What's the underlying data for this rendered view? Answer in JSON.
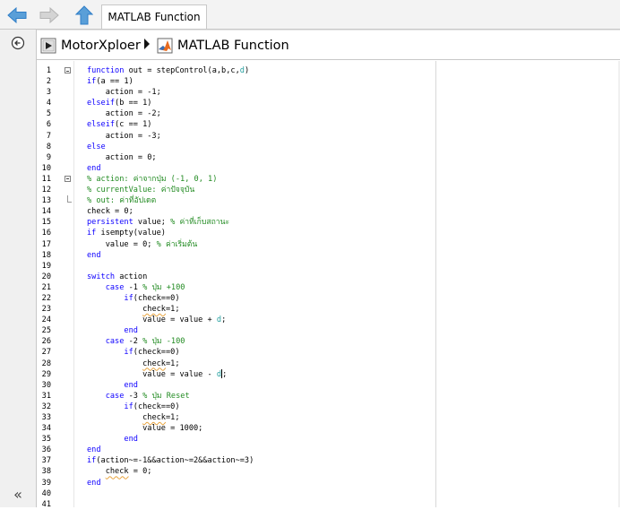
{
  "toolbar": {
    "back_icon": "arrow-left-icon",
    "forward_icon": "arrow-right-icon",
    "up_icon": "arrow-up-icon",
    "tab_label": "MATLAB Function"
  },
  "breadcrumb": {
    "model": "MotorXploer",
    "block": "MATLAB Function"
  },
  "sidebar": {
    "hide_icon": "collapse-icon",
    "collapse_label": "«"
  },
  "colors": {
    "keyword": "#0e00ff",
    "comment": "#228b22",
    "persistent_var": "#26a0a0",
    "nav_arrow": "#2f7ec7"
  },
  "editor": {
    "lines": [
      {
        "n": "1",
        "html": "<span class=\"kw\">function</span> out = stepControl(a,b,c,<span class=\"pv\">d</span>)"
      },
      {
        "n": "2",
        "html": "<span class=\"kw\">if</span>(a == 1)"
      },
      {
        "n": "3",
        "html": "    action = -1;"
      },
      {
        "n": "4",
        "html": "<span class=\"kw\">elseif</span>(b == 1)"
      },
      {
        "n": "5",
        "html": "    action = -2;"
      },
      {
        "n": "6",
        "html": "<span class=\"kw\">elseif</span>(c == 1)"
      },
      {
        "n": "7",
        "html": "    action = -3;"
      },
      {
        "n": "8",
        "html": "<span class=\"kw\">else</span>"
      },
      {
        "n": "9",
        "html": "    action = 0;"
      },
      {
        "n": "10",
        "html": "<span class=\"kw\">end</span>"
      },
      {
        "n": "11",
        "html": "<span class=\"cm\">% action: ค่าจากปุ่ม (-1, 0, 1)</span>"
      },
      {
        "n": "12",
        "html": "<span class=\"cm\">% currentValue: ค่าปัจจุบัน</span>"
      },
      {
        "n": "13",
        "html": "<span class=\"cm\">% out: ค่าที่อัปเดต</span>"
      },
      {
        "n": "14",
        "html": "check = 0;"
      },
      {
        "n": "15",
        "html": "<span class=\"kw\">persistent</span> value; <span class=\"cm\">% ค่าที่เก็บสถานะ</span>"
      },
      {
        "n": "16",
        "html": "<span class=\"kw\">if</span> isempty(value)"
      },
      {
        "n": "17",
        "html": "    value = 0; <span class=\"cm\">% ค่าเริ่มต้น</span>"
      },
      {
        "n": "18",
        "html": "<span class=\"kw\">end</span>"
      },
      {
        "n": "19",
        "html": ""
      },
      {
        "n": "20",
        "html": "<span class=\"kw\">switch</span> action"
      },
      {
        "n": "21",
        "html": "    <span class=\"kw\">case</span> -1 <span class=\"cm\">% ปุ่ม +100</span>"
      },
      {
        "n": "22",
        "html": "        <span class=\"kw\">if</span>(check==0)"
      },
      {
        "n": "23",
        "html": "            <span class=\"ul\">check</span>=1;"
      },
      {
        "n": "24",
        "html": "            value = value + <span class=\"pv\">d</span>;"
      },
      {
        "n": "25",
        "html": "        <span class=\"kw\">end</span>"
      },
      {
        "n": "26",
        "html": "    <span class=\"kw\">case</span> -2 <span class=\"cm\">% ปุ่ม -100</span>"
      },
      {
        "n": "27",
        "html": "        <span class=\"kw\">if</span>(check==0)"
      },
      {
        "n": "28",
        "html": "            <span class=\"ul\">check</span>=1;"
      },
      {
        "n": "29",
        "html": "            value = value - <span class=\"pv\">d</span><span class=\"cursor\"></span>;"
      },
      {
        "n": "30",
        "html": "        <span class=\"kw\">end</span>"
      },
      {
        "n": "31",
        "html": "    <span class=\"kw\">case</span> -3 <span class=\"cm\">% ปุ่ม Reset</span>"
      },
      {
        "n": "32",
        "html": "        <span class=\"kw\">if</span>(check==0)"
      },
      {
        "n": "33",
        "html": "            <span class=\"ul\">check</span>=1;"
      },
      {
        "n": "34",
        "html": "            value = 1000;"
      },
      {
        "n": "35",
        "html": "        <span class=\"kw\">end</span>"
      },
      {
        "n": "36",
        "html": "<span class=\"kw\">end</span>"
      },
      {
        "n": "37",
        "html": "<span class=\"kw\">if</span>(action~=-1&amp;&amp;action~=2&amp;&amp;action~=3)"
      },
      {
        "n": "38",
        "html": "    <span class=\"ul\">check</span> = 0;"
      },
      {
        "n": "39",
        "html": "<span class=\"kw\">end</span>"
      },
      {
        "n": "40",
        "html": ""
      },
      {
        "n": "41",
        "html": ""
      }
    ]
  }
}
